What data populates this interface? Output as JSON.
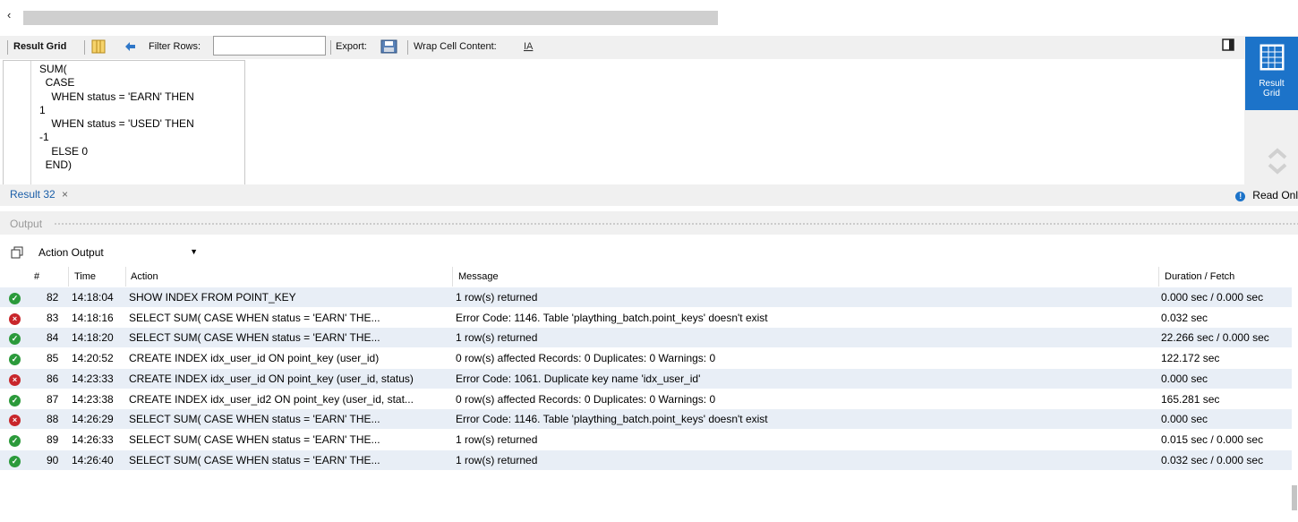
{
  "toolbar": {
    "result_grid": "Result Grid",
    "filter_rows": "Filter Rows:",
    "filter_value": "",
    "export": "Export:",
    "wrap_cell": "Wrap Cell Content:"
  },
  "cell_content": "SUM(\n  CASE\n    WHEN status = 'EARN' THEN\n1\n    WHEN status = 'USED' THEN\n-1\n    ELSE 0\n  END)",
  "side_panel": {
    "result_grid_label_1": "Result",
    "result_grid_label_2": "Grid"
  },
  "result_tab": {
    "label": "Result 32",
    "close": "×",
    "read_only": "Read Onl"
  },
  "output": {
    "label": "Output",
    "selector_value": "Action Output",
    "columns": [
      "#",
      "Time",
      "Action",
      "Message",
      "Duration / Fetch"
    ],
    "rows": [
      {
        "status": "ok",
        "num": "82",
        "time": "14:18:04",
        "action": "SHOW INDEX FROM POINT_KEY",
        "message": "1 row(s) returned",
        "duration": "0.000 sec / 0.000 sec"
      },
      {
        "status": "err",
        "num": "83",
        "time": "14:18:16",
        "action": "SELECT SUM(   CASE         WHEN status = 'EARN' THE...",
        "message": "Error Code: 1146. Table 'plaything_batch.point_keys' doesn't exist",
        "duration": "0.032 sec"
      },
      {
        "status": "ok",
        "num": "84",
        "time": "14:18:20",
        "action": "SELECT SUM(   CASE         WHEN status = 'EARN' THE...",
        "message": "1 row(s) returned",
        "duration": "22.266 sec / 0.000 sec"
      },
      {
        "status": "ok",
        "num": "85",
        "time": "14:20:52",
        "action": "CREATE INDEX idx_user_id ON point_key (user_id)",
        "message": "0 row(s) affected Records: 0  Duplicates: 0  Warnings: 0",
        "duration": "122.172 sec"
      },
      {
        "status": "err",
        "num": "86",
        "time": "14:23:33",
        "action": "CREATE INDEX idx_user_id ON point_key (user_id, status)",
        "message": "Error Code: 1061. Duplicate key name 'idx_user_id'",
        "duration": "0.000 sec"
      },
      {
        "status": "ok",
        "num": "87",
        "time": "14:23:38",
        "action": "CREATE INDEX idx_user_id2 ON point_key (user_id, stat...",
        "message": "0 row(s) affected Records: 0  Duplicates: 0  Warnings: 0",
        "duration": "165.281 sec"
      },
      {
        "status": "err",
        "num": "88",
        "time": "14:26:29",
        "action": "SELECT SUM(   CASE         WHEN status = 'EARN' THE...",
        "message": "Error Code: 1146. Table 'plaything_batch.point_keys' doesn't exist",
        "duration": "0.000 sec"
      },
      {
        "status": "ok",
        "num": "89",
        "time": "14:26:33",
        "action": "SELECT SUM(   CASE         WHEN status = 'EARN' THE...",
        "message": "1 row(s) returned",
        "duration": "0.015 sec / 0.000 sec"
      },
      {
        "status": "ok",
        "num": "90",
        "time": "14:26:40",
        "action": "SELECT SUM(   CASE         WHEN status = 'EARN' THE...",
        "message": "1 row(s) returned",
        "duration": "0.032 sec / 0.000 sec"
      }
    ]
  },
  "colors": {
    "accent": "#1c73c9",
    "ok": "#2b9a3b",
    "error": "#c8262b",
    "row_alt": "#e8eef6"
  }
}
